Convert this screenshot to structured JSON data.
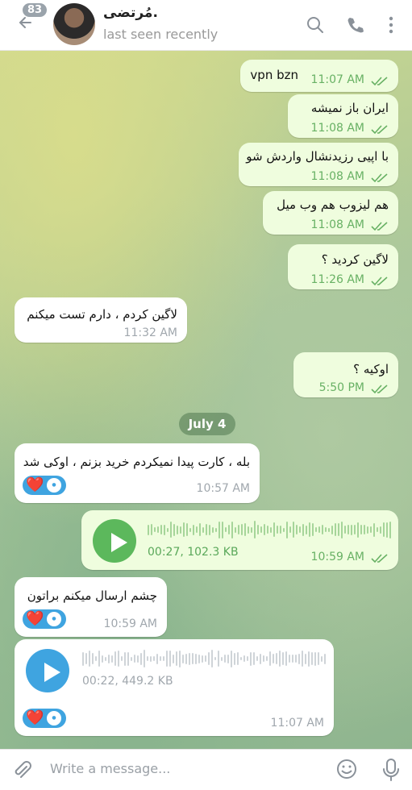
{
  "header": {
    "back_badge": "83",
    "contact_name": "مُرتضی.",
    "status": "last seen recently"
  },
  "messages": {
    "m1": {
      "text": "vpn bzn",
      "time": "11:07 AM"
    },
    "m2": {
      "text": "ایران باز نمیشه",
      "time": "11:08 AM"
    },
    "m3": {
      "text": "با اپیی رزیدنشال واردش شو",
      "time": "11:08 AM"
    },
    "m4": {
      "text": "هم لیزوب هم وب میل",
      "time": "11:08 AM"
    },
    "m5": {
      "text": "لاگین کردید ؟",
      "time": "11:26 AM"
    },
    "m6": {
      "text": "لاگین کردم ، دارم تست میکنم",
      "time": "11:32 AM"
    },
    "m7": {
      "text": "اوکیه ؟",
      "time": "5:50 PM"
    },
    "date_divider": "July 4",
    "m8": {
      "text": "بله ، کارت پیدا نمیکردم  خرید بزنم ، اوکی شد",
      "time": "10:57 AM",
      "reaction": "❤️"
    },
    "m9": {
      "duration_size": "00:27, 102.3 KB",
      "time": "10:59 AM"
    },
    "m10": {
      "text": "چشم ارسال میکنم  براتون",
      "time": "10:59 AM",
      "reaction": "❤️"
    },
    "m11": {
      "duration_size": "00:22, 449.2 KB",
      "time": "11:07 AM",
      "reaction": "❤️"
    }
  },
  "composer": {
    "placeholder": "Write a message..."
  },
  "colors": {
    "outgoing_bubble": "#effdde",
    "incoming_bubble": "#ffffff",
    "accent_green": "#5cb85c",
    "accent_blue": "#3fa4e0"
  },
  "icons": [
    "back-arrow-icon",
    "search-icon",
    "phone-icon",
    "more-vertical-icon",
    "check-double-icon",
    "play-icon",
    "heart-icon",
    "paperclip-icon",
    "emoji-icon",
    "microphone-icon"
  ]
}
